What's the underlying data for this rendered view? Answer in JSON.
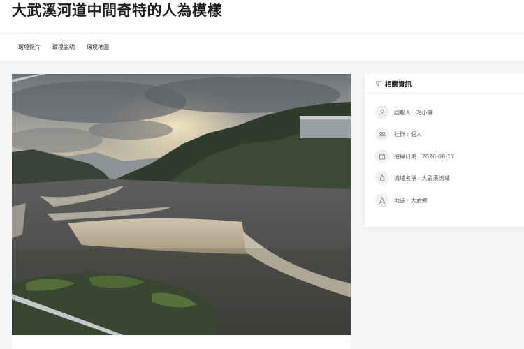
{
  "page": {
    "title": "大武溪河道中間奇特的人為模樣"
  },
  "nav": {
    "tabs": [
      {
        "label": "環境照片"
      },
      {
        "label": "環境說明"
      },
      {
        "label": "環境地圖"
      }
    ]
  },
  "info": {
    "header_icon": "tag-icon",
    "title": "相關資訊",
    "rows": [
      {
        "icon": "person-icon",
        "text": "回報人 : 毛小驛"
      },
      {
        "icon": "group-icon",
        "text": "社群 : 個人"
      },
      {
        "icon": "calendar-icon",
        "text": "拍攝日期 : 2026-08-17"
      },
      {
        "icon": "water-drop-icon",
        "text": "流域名稱 : 大武溪流域"
      },
      {
        "icon": "location-icon",
        "text": "地區 : 大武鄉"
      }
    ]
  },
  "colors": {
    "background": "#f5f6f8",
    "card": "#ffffff",
    "title_text": "#1e1e1e"
  }
}
